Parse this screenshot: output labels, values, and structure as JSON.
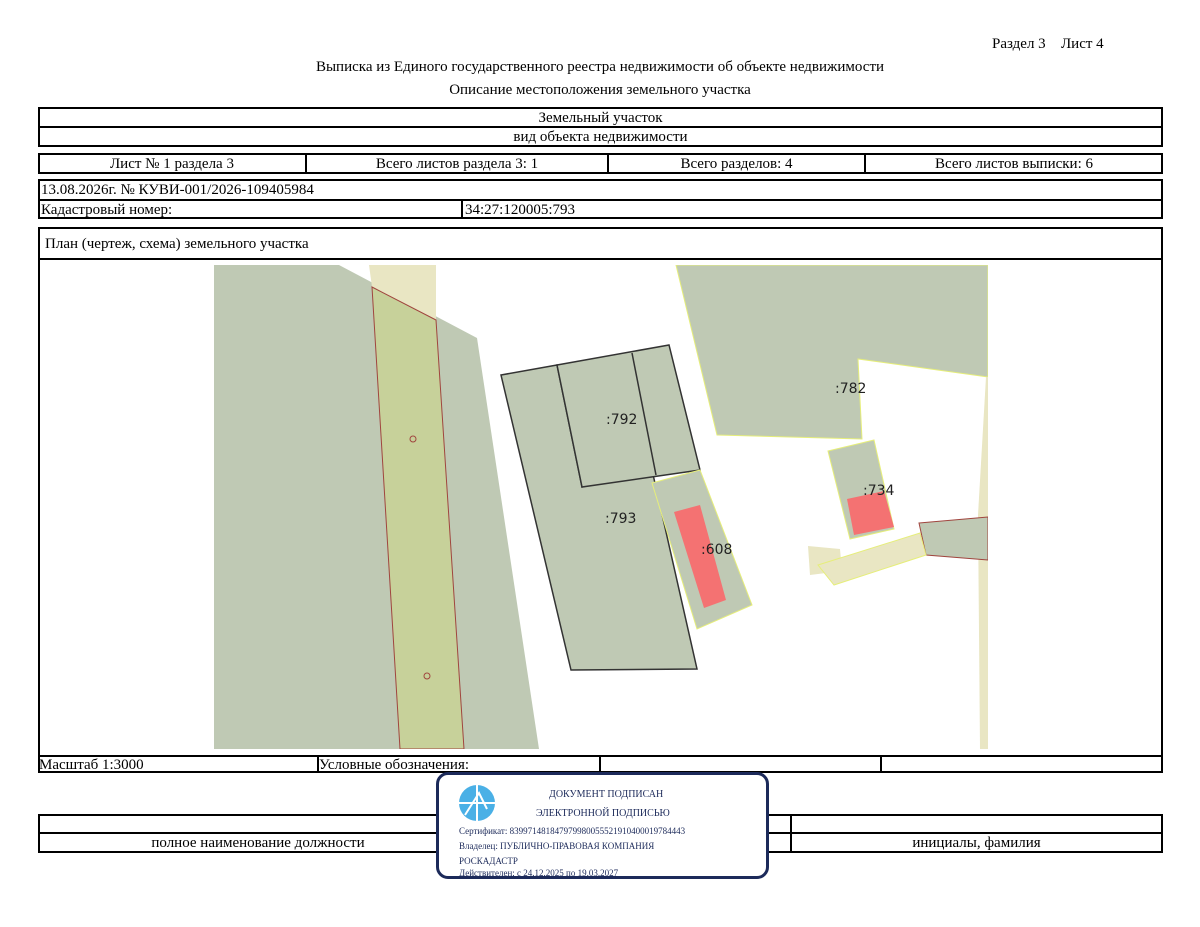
{
  "header": {
    "section": "Раздел 3",
    "sheet": "Лист 4",
    "title": "Выписка из Единого государственного реестра недвижимости об объекте недвижимости",
    "subtitle": "Описание местоположения земельного участка"
  },
  "object": {
    "type": "Земельный участок",
    "type_caption": "вид объекта недвижимости"
  },
  "sheet_info": {
    "sheet_no": "Лист № 1 раздела 3",
    "total_section_sheets": "Всего листов раздела 3: 1",
    "total_sections": "Всего разделов: 4",
    "total_extract_sheets": "Всего листов выписки: 6"
  },
  "record": {
    "date_number": "13.08.2026г. № КУВИ-001/2026-109405984",
    "cadastral_label": "Кадастровый номер:",
    "cadastral_value": "34:27:120005:793"
  },
  "plan": {
    "title": "План (чертеж, схема) земельного участка",
    "parcels": [
      ":782",
      ":792",
      ":793",
      ":608",
      ":734"
    ],
    "colors": {
      "parcel": "#bfc9b4",
      "road": "#e9e6c3",
      "strip": "#c7d19a",
      "building": "#f47272",
      "outline": "#e6ee7a",
      "selected_outline": "#333333"
    }
  },
  "footer": {
    "scale": "Масштаб 1:3000",
    "legend_label": "Условные обозначения:",
    "position_caption": "полное наименование должности",
    "name_caption": "инициалы, фамилия"
  },
  "stamp": {
    "line1": "ДОКУМЕНТ ПОДПИСАН",
    "line2": "ЭЛЕКТРОННОЙ ПОДПИСЬЮ",
    "certificate": "Сертификат: 839971481847979980055521910400019784443",
    "owner_line1": "Владелец: ПУБЛИЧНО-ПРАВОВАЯ КОМПАНИЯ",
    "owner_line2": "РОСКАДАСТР",
    "valid": "Действителен: с 24.12.2025 по 19.03.2027",
    "icon": "emblem-icon",
    "color": "#1c2a5a"
  }
}
